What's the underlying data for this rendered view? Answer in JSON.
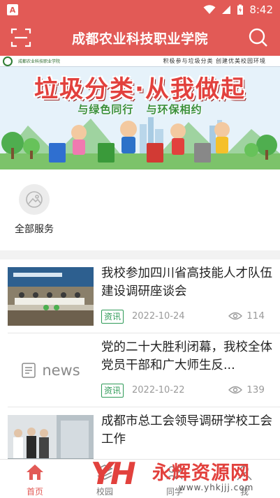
{
  "status_bar": {
    "time": "8:42",
    "left_icon": "A"
  },
  "header": {
    "title": "成都农业科技职业学院",
    "left_icon": "scan-icon",
    "right_icon": "search-icon"
  },
  "banner": {
    "top_slogan": "积极参与垃圾分类  创建优美校园环境",
    "school_name": "成都农业科技职业学院",
    "headline": "垃圾分类·从我做起",
    "sub_left": "与绿色同行",
    "sub_right": "与环保相约"
  },
  "services": {
    "items": [
      {
        "label": "全部服务",
        "icon": "all-services-icon"
      }
    ]
  },
  "news": {
    "items": [
      {
        "title": "我校参加四川省高技能人才队伍建设调研座谈会",
        "tag": "资讯",
        "date": "2022-10-24",
        "views": "114",
        "thumb": "meeting-photo"
      },
      {
        "title": "党的二十大胜利闭幕，我校全体党员干部和广大师生反...",
        "tag": "资讯",
        "date": "2022-10-22",
        "views": "139",
        "thumb": "news-placeholder",
        "thumb_text": "news"
      },
      {
        "title": "成都市总工会领导调研学校工会工作",
        "thumb": "visit-photo"
      }
    ]
  },
  "bottom_nav": {
    "items": [
      {
        "label": "首页",
        "icon": "home-icon",
        "active": true
      },
      {
        "label": "校园",
        "icon": "campus-icon",
        "active": false
      },
      {
        "label": "同学",
        "icon": "classmates-icon",
        "active": false
      },
      {
        "label": "我",
        "icon": "profile-icon",
        "active": false
      }
    ]
  },
  "watermark": {
    "logo": "YH",
    "text": "永辉资源网",
    "url": "www.yhkjjj.com"
  },
  "colors": {
    "brand": "#e25a56",
    "tag_green": "#2e9a57",
    "meta_gray": "#9a9a9a"
  }
}
